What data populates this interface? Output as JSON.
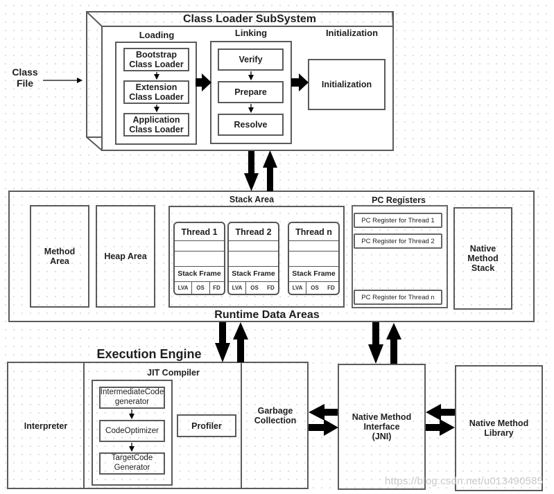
{
  "class_file": {
    "label_line1": "Class",
    "label_line2": "File"
  },
  "class_loader": {
    "title": "Class Loader SubSystem",
    "loading": {
      "title": "Loading",
      "items": [
        {
          "line1": "Bootstrap",
          "line2": "Class Loader"
        },
        {
          "line1": "Extension",
          "line2": "Class Loader"
        },
        {
          "line1": "Application",
          "line2": "Class Loader"
        }
      ]
    },
    "linking": {
      "title": "Linking",
      "items": [
        "Verify",
        "Prepare",
        "Resolve"
      ]
    },
    "initialization": {
      "title": "Initialization",
      "box_label": "Initialization"
    }
  },
  "runtime_data_areas": {
    "title": "Runtime Data Areas",
    "method_area": {
      "line1": "Method",
      "line2": "Area"
    },
    "heap_area": "Heap Area",
    "stack_area": {
      "title": "Stack Area",
      "threads": [
        {
          "name": "Thread 1",
          "frame": "Stack Frame",
          "cells": [
            "LVA",
            "OS",
            "FD"
          ]
        },
        {
          "name": "Thread 2",
          "frame": "Stack Frame",
          "cells": [
            "LVA",
            "OS",
            "FD"
          ]
        },
        {
          "name": "Thread n",
          "frame": "Stack Frame",
          "cells": [
            "LVA",
            "OS",
            "FD"
          ]
        }
      ]
    },
    "pc_registers": {
      "title": "PC Registers",
      "items": [
        "PC Register for Thread 1",
        "PC Register for Thread 2",
        "PC Register for Thread n"
      ]
    },
    "native_method_stack": {
      "line1": "Native",
      "line2": "Method",
      "line3": "Stack"
    }
  },
  "execution_engine": {
    "title": "Execution Engine",
    "interpreter": "Interpreter",
    "jit_compiler": {
      "title": "JIT Compiler",
      "items": [
        {
          "line1": "IntermediateCode",
          "line2": "generator"
        },
        {
          "line1": "CodeOptimizer",
          "line2": ""
        },
        {
          "line1": "TargetCode",
          "line2": "Generator"
        }
      ],
      "profiler": "Profiler"
    },
    "garbage_collection": {
      "line1": "Garbage",
      "line2": "Collection"
    }
  },
  "jni": {
    "line1": "Native Method",
    "line2": "Interface",
    "line3": "(JNI)"
  },
  "native_library": {
    "line1": "Native Method",
    "line2": "Library"
  },
  "watermark": "https://blog.csdn.net/u013490585",
  "colors": {
    "stroke": "#5a5a5a",
    "text": "#1e1e1e",
    "arrow": "#000000"
  }
}
